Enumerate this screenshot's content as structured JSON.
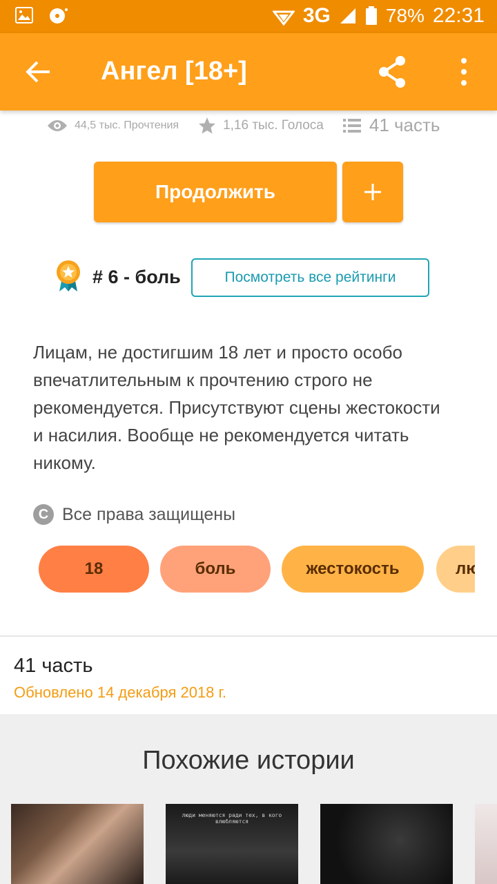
{
  "statusbar": {
    "network": "3G",
    "battery": "78%",
    "time": "22:31",
    "left_icons": [
      "image-icon",
      "media-icon"
    ]
  },
  "appbar": {
    "title": "Ангел [18+]",
    "back_icon": "arrow-back-icon",
    "share_icon": "share-icon",
    "more_icon": "more-vert-icon"
  },
  "stats": {
    "reads": "44,5 тыс. Прочтения",
    "votes": "1,16 тыс. Голоса",
    "parts": "41 часть"
  },
  "actions": {
    "continue_label": "Продолжить",
    "add_label": "+"
  },
  "ranking": {
    "rank_text": "# 6 - боль",
    "view_all_label": "Посмотреть все рейтинги"
  },
  "description": "Лицам, не достигшим 18 лет и просто особо впечатлительным к прочтению строго не рекомендуется. Присутствуют сцены жестокости и насилия. Вообще не рекомендуется читать никому.",
  "copyright": {
    "symbol": "C",
    "text": "Все права защищены"
  },
  "tags": [
    {
      "label": "18",
      "color": "#ff7f45"
    },
    {
      "label": "боль",
      "color": "#ffa27a"
    },
    {
      "label": "жестокость",
      "color": "#ffb347"
    },
    {
      "label": "лю",
      "color": "#ffcf8a"
    }
  ],
  "parts_section": {
    "title": "41 часть",
    "updated": "Обновлено 14 декабря 2018 г."
  },
  "similar": {
    "title": "Похожие истории",
    "cover2_caption": "люди меняются ради тех, в кого влюбляются"
  },
  "colors": {
    "status_bar": "#f08c00",
    "app_bar": "#ff9f1a",
    "accent_teal": "#1fa5b5",
    "updated_text": "#f39c12"
  }
}
